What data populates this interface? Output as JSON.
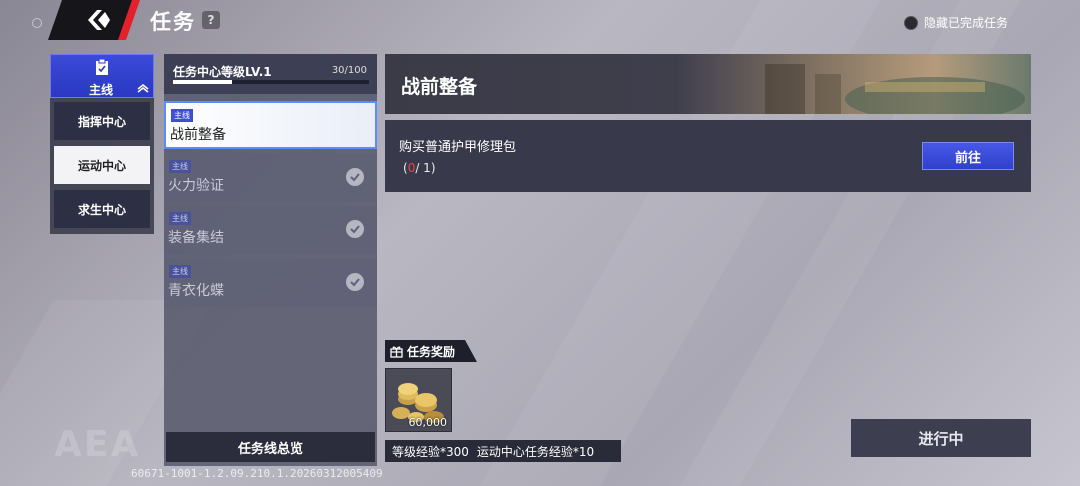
{
  "header": {
    "title": "任务",
    "help": "?",
    "hide_completed_label": "隐藏已完成任务"
  },
  "sidebar": {
    "main_tab": "主线",
    "items": [
      {
        "label": "指挥中心",
        "active": false
      },
      {
        "label": "运动中心",
        "active": true
      },
      {
        "label": "求生中心",
        "active": false
      }
    ]
  },
  "quest_list": {
    "level_label": "任务中心等级LV.1",
    "level_progress": "30/100",
    "level_fraction": 0.3,
    "quests": [
      {
        "tag": "主线",
        "name": "战前整备",
        "state": "active"
      },
      {
        "tag": "主线",
        "name": "火力验证",
        "state": "done"
      },
      {
        "tag": "主线",
        "name": "装备集结",
        "state": "done"
      },
      {
        "tag": "主线",
        "name": "青衣化蝶",
        "state": "done"
      }
    ],
    "overview_button": "任务线总览"
  },
  "detail": {
    "title": "战前整备",
    "task_name": "购买普通护甲修理包",
    "progress_current": "0",
    "progress_total": "/ 1",
    "goto_button": "前往"
  },
  "rewards": {
    "header": "任务奖励",
    "item_quantity": "60,000",
    "exp_level": "等级经验*300",
    "exp_center": "运动中心任务经验*10"
  },
  "status_button": "进行中",
  "footer": {
    "watermark": "AEA",
    "version": "60671-1001-1.2.09.210.1.20260312005409"
  }
}
